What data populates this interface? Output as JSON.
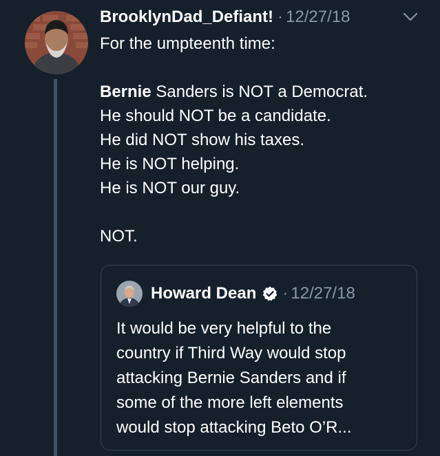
{
  "tweet": {
    "display_name": "BrooklynDad_Defiant!",
    "separator": "·",
    "timestamp": "12/27/18",
    "menu_icon": "chevron-down-icon",
    "lines": [
      "For the umpteenth time:",
      "",
      "Sanders is NOT a Democrat.",
      "He should NOT be a candidate.",
      "He did NOT show his taxes.",
      "He is NOT helping.",
      "He is NOT our guy.",
      "",
      "NOT."
    ],
    "bold_word": "Bernie"
  },
  "quoted": {
    "display_name": "Howard Dean",
    "verified_icon": "verified-badge-icon",
    "separator": "·",
    "timestamp": "12/27/18",
    "lines": [
      "It would be very helpful to the",
      "country if Third Way would stop",
      "attacking Bernie Sanders and if",
      "some of the more left elements",
      "would stop attacking Beto O’R..."
    ]
  },
  "colors": {
    "background": "#15202b",
    "secondary_text": "#8899a6",
    "thread_line": "#3d5466",
    "card_border": "#38444d",
    "verified": "#ffffff"
  }
}
